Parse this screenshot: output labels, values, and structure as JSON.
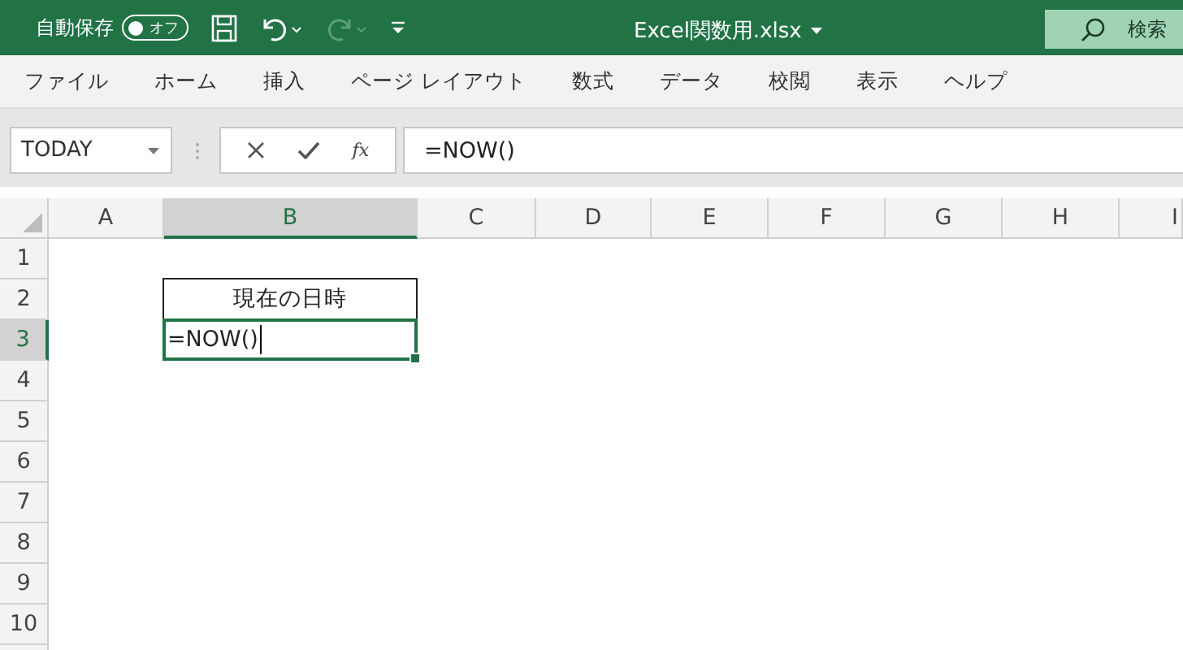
{
  "title_bar": {
    "autosave": {
      "label": "自動保存",
      "on": false,
      "state_label": "オフ"
    },
    "quick_access": [
      {
        "kind": "save",
        "disabled": false
      },
      {
        "kind": "undo",
        "disabled": false
      },
      {
        "kind": "redo",
        "disabled": true
      },
      {
        "kind": "customize",
        "disabled": false
      }
    ],
    "file_name": "Excel関数用.xlsx",
    "search": {
      "placeholder": "検索"
    }
  },
  "ribbon_tabs": [
    {
      "label": "ファイル",
      "selected": false
    },
    {
      "label": "ホーム",
      "selected": false
    },
    {
      "label": "挿入",
      "selected": false
    },
    {
      "label": "ページ レイアウト",
      "selected": false
    },
    {
      "label": "数式",
      "selected": false
    },
    {
      "label": "データ",
      "selected": false
    },
    {
      "label": "校閲",
      "selected": false
    },
    {
      "label": "表示",
      "selected": false
    },
    {
      "label": "ヘルプ",
      "selected": false
    }
  ],
  "formula_bar": {
    "name_box": "TODAY",
    "function_button": "fx",
    "formula": "=NOW()"
  },
  "sheet": {
    "columns": [
      {
        "label": "A",
        "selected": false
      },
      {
        "label": "B",
        "selected": true
      },
      {
        "label": "C",
        "selected": false
      },
      {
        "label": "D",
        "selected": false
      },
      {
        "label": "E",
        "selected": false
      },
      {
        "label": "F",
        "selected": false
      },
      {
        "label": "G",
        "selected": false
      },
      {
        "label": "H",
        "selected": false
      },
      {
        "label": "I",
        "selected": false
      }
    ],
    "rows": [
      {
        "label": "1",
        "selected": false,
        "cells": []
      },
      {
        "label": "2",
        "selected": false,
        "cells": [
          null,
          {
            "text": "現在の日時",
            "kind": "bordered"
          }
        ]
      },
      {
        "label": "3",
        "selected": true,
        "cells": [
          null,
          {
            "text": "=NOW()",
            "kind": "editing"
          }
        ]
      },
      {
        "label": "4",
        "selected": false,
        "cells": []
      },
      {
        "label": "5",
        "selected": false,
        "cells": []
      },
      {
        "label": "6",
        "selected": false,
        "cells": []
      },
      {
        "label": "7",
        "selected": false,
        "cells": []
      },
      {
        "label": "8",
        "selected": false,
        "cells": []
      },
      {
        "label": "9",
        "selected": false,
        "cells": []
      },
      {
        "label": "10",
        "selected": false,
        "cells": []
      }
    ]
  }
}
